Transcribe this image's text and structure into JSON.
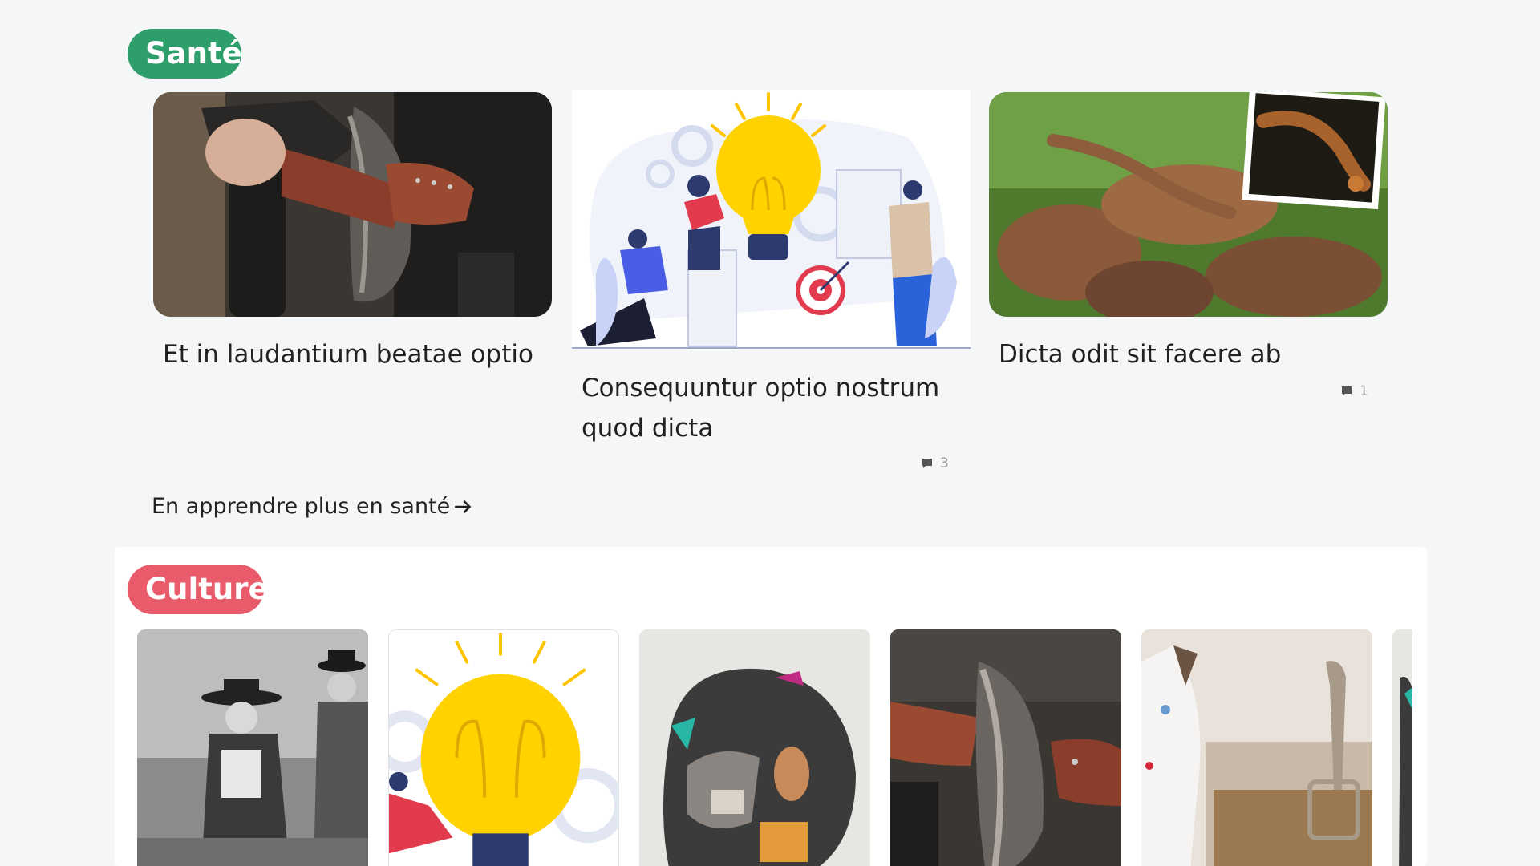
{
  "sante": {
    "badge": "Santé",
    "badge_color": "#2e9e6b",
    "articles": [
      {
        "title": "Et in laudantium beatae optio",
        "image": "axe-warrior"
      },
      {
        "title": "Consequuntur optio nostrum quod dicta",
        "image": "lightbulb-illustration",
        "comments": "3"
      },
      {
        "title": "Dicta odit sit facere ab",
        "image": "leaf-gecko",
        "comments": "1"
      }
    ],
    "more_link": "En apprendre plus en santé"
  },
  "culture": {
    "badge": "Culture",
    "badge_color": "#e95a6a",
    "cards": [
      {
        "image": "vintage-photo-men"
      },
      {
        "image": "lightbulb-illustration"
      },
      {
        "image": "collage-portrait"
      },
      {
        "image": "axe-warrior"
      },
      {
        "image": "kitten-litter"
      },
      {
        "image": "partial-card"
      }
    ]
  }
}
